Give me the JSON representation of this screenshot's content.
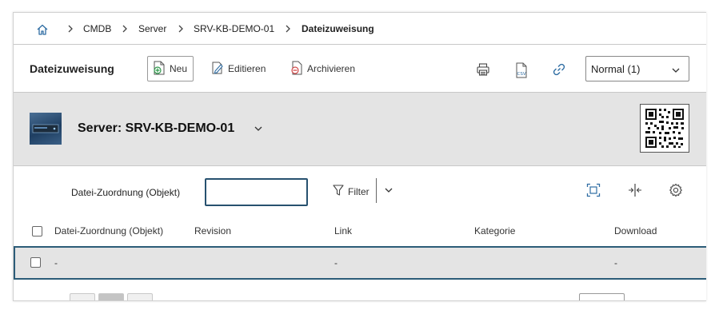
{
  "breadcrumb": {
    "items": [
      {
        "label": "CMDB"
      },
      {
        "label": "Server"
      },
      {
        "label": "SRV-KB-DEMO-01"
      },
      {
        "label": "Dateizuweisung"
      }
    ]
  },
  "toolbar": {
    "title": "Dateizuweisung",
    "new_label": "Neu",
    "edit_label": "Editieren",
    "archive_label": "Archivieren",
    "view_select_value": "Normal (1)"
  },
  "object": {
    "title": "Server: SRV-KB-DEMO-01"
  },
  "filter": {
    "field_label": "Datei-Zuordnung (Objekt)",
    "input_value": "",
    "filter_label": "Filter"
  },
  "table": {
    "columns": [
      "Datei-Zuordnung (Objekt)",
      "Revision",
      "Link",
      "Kategorie",
      "Download"
    ],
    "rows": [
      {
        "cells": [
          "-",
          "",
          "-",
          "",
          "-"
        ]
      }
    ]
  },
  "colors": {
    "accent": "#2c5c78",
    "header_bg": "#e4e4e4",
    "icon_blue": "#2f6da3",
    "archive_red": "#d24b4b",
    "new_green": "#2e9a4b"
  }
}
